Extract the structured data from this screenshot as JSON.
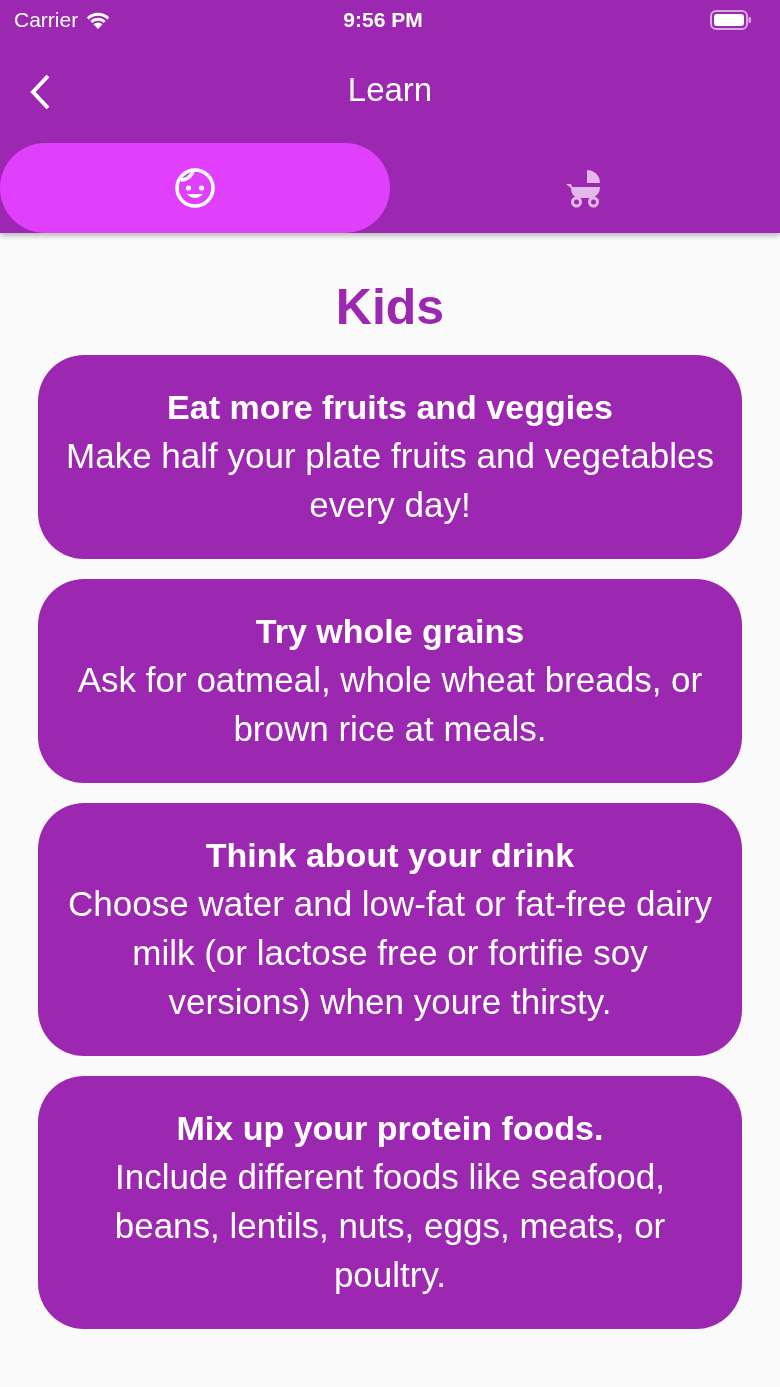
{
  "status_bar": {
    "carrier": "Carrier",
    "time": "9:56 PM"
  },
  "nav_bar": {
    "title": "Learn"
  },
  "tabs": [
    {
      "kind": "child",
      "selected": true
    },
    {
      "kind": "stroller",
      "selected": false
    }
  ],
  "heading": "Kids",
  "cards": [
    {
      "title": "Eat more fruits and veggies",
      "text": "Make half your plate fruits and vegetables every day!"
    },
    {
      "title": "Try whole grains",
      "text": "Ask for oatmeal, whole wheat breads, or brown rice at meals."
    },
    {
      "title": "Think about your drink",
      "text": "Choose water and low-fat or fat-free dairy milk (or lactose free or fortifie soy versions) when youre thirsty."
    },
    {
      "title": "Mix up your protein foods.",
      "text": "Include different foods like seafood, beans, lentils, nuts, eggs, meats, or poultry."
    }
  ]
}
